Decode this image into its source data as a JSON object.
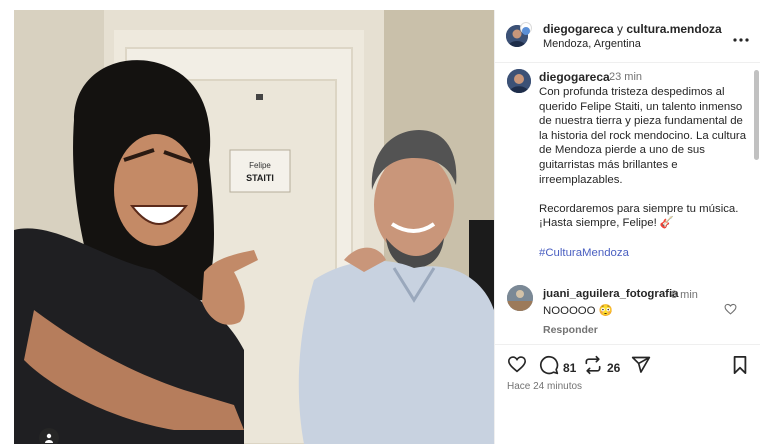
{
  "post": {
    "header": {
      "author": "diegogareca",
      "connector": " y ",
      "coauthor": "cultura.mendoza",
      "location": "Mendoza, Argentina",
      "more_icon": "more-horizontal-icon"
    },
    "caption": {
      "username": "diegogareca",
      "time": "23 min",
      "paragraph1": "Con profunda tristeza despedimos al querido Felipe Staiti, un talento inmenso de nuestra tierra y pieza fundamental de la historia del rock mendocino. La cultura de Mendoza pierde a uno de sus guitarristas más brillantes e irreemplazables.",
      "paragraph2": "Recordaremos para siempre tu música. ¡Hasta siempre, Felipe! 🎸",
      "hashtag": "#CulturaMendoza"
    },
    "comments": [
      {
        "username": "juani_aguilera_fotografia",
        "time": "8 min",
        "text": "NOOOOO 😳",
        "reply_label": "Responder"
      }
    ],
    "door_sign": {
      "line1": "Felipe",
      "line2": "STAITI"
    },
    "actions": {
      "comment_count": "81",
      "repost_count": "26"
    },
    "timestamp": "Hace 24 minutos"
  },
  "colors": {
    "text": "#262626",
    "secondary": "#737373",
    "hashtag": "#4a5fc1",
    "divider": "#efefef"
  }
}
